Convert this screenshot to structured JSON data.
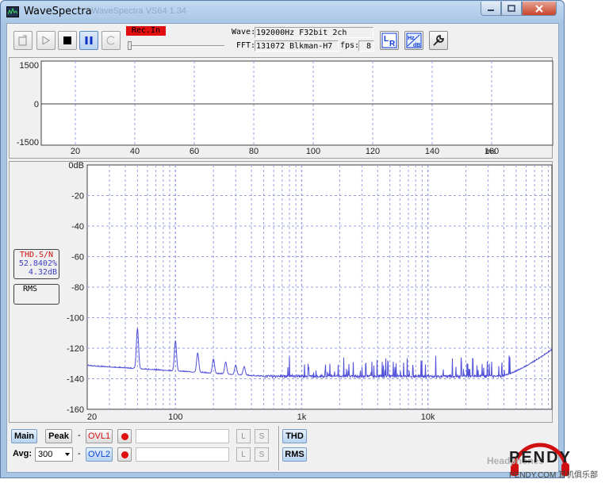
{
  "window": {
    "title": "WaveSpectra",
    "ghost_title": "WaveSpectra VS64 1.34"
  },
  "toolbar": {
    "rec_indicator": "Rec.In",
    "wave_label": "Wave:",
    "wave_value": "192000Hz F32bit 2ch",
    "fft_label": "FFT:",
    "fft_value": "131072 Blkman-H7",
    "fps_label": "fps:",
    "fps_value": "8"
  },
  "waveform": {
    "y_ticks": [
      "1500",
      "0",
      "-1500"
    ],
    "x_ticks": [
      "20",
      "40",
      "60",
      "80",
      "100",
      "120",
      "140",
      "160"
    ],
    "x_unit": "ms"
  },
  "spectrum": {
    "y_ticks": [
      "0dB",
      "-20",
      "-40",
      "-60",
      "-80",
      "-100",
      "-120",
      "-140",
      "-160"
    ],
    "x_ticks": [
      "20",
      "100",
      "1k",
      "10k"
    ],
    "line_color": "#5050d8"
  },
  "readouts": {
    "thd_label": "THD.S/N",
    "thd_value": "52.8402%",
    "sn_value": "4.32dB",
    "rms_label": "RMS"
  },
  "bottom": {
    "main_label": "Main",
    "peak_label": "Peak",
    "dash": "-",
    "ovl1_label": "OVL1",
    "ovl2_label": "OVL2",
    "l_label": "L",
    "s_label": "S",
    "avg_label": "Avg:",
    "avg_value": "300",
    "thd_button": "THD",
    "rms_button": "RMS"
  },
  "watermark": {
    "line1": "Headphones",
    "brand": "PENDY",
    "sub": "PENDY.COM 耳机俱乐部"
  },
  "colors": {
    "accent": "#0a3bd8",
    "record_red": "#e01010",
    "grid": "#9aa0e0",
    "spectrum_line": "#5050d8"
  }
}
